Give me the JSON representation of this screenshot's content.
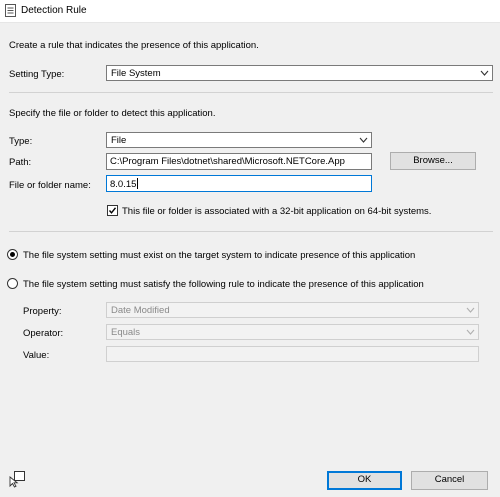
{
  "window": {
    "title": "Detection Rule"
  },
  "intro": {
    "text": "Create a rule that indicates the presence of this application."
  },
  "setting_type": {
    "label": "Setting Type:",
    "value": "File System"
  },
  "section2": {
    "text": "Specify the file or folder to detect this application."
  },
  "type": {
    "label": "Type:",
    "value": "File"
  },
  "path": {
    "label": "Path:",
    "value": "C:\\Program Files\\dotnet\\shared\\Microsoft.NETCore.App",
    "browse_label": "Browse..."
  },
  "file_name": {
    "label": "File or folder name:",
    "value": "8.0.15"
  },
  "bit32": {
    "label": "This file or folder is associated with a 32-bit application on 64-bit systems.",
    "checked": true
  },
  "radio_exist": {
    "label": "The file system setting must exist on the target system to indicate presence of this application",
    "selected": true
  },
  "radio_rule": {
    "label": "The file system setting must satisfy the following rule to indicate the presence of this application",
    "selected": false
  },
  "rule": {
    "property_label": "Property:",
    "property_value": "Date Modified",
    "operator_label": "Operator:",
    "operator_value": "Equals",
    "value_label": "Value:",
    "value_value": ""
  },
  "footer": {
    "ok_label": "OK",
    "cancel_label": "Cancel",
    "help_icon": "help-pointer-icon"
  },
  "colors": {
    "accent": "#0078d7",
    "background": "#f0f0f0"
  }
}
